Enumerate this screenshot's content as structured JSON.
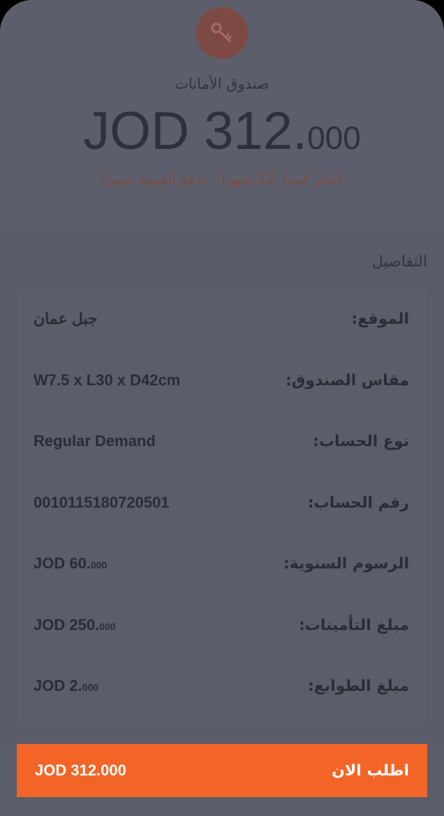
{
  "header": {
    "icon": "key-icon",
    "title": "صندوق الأمانات",
    "amount_main": "JOD 312.",
    "amount_decimals": "000",
    "note": "ايجار لمدة 12 شهرا ، تدفع القيمة سنويا"
  },
  "details": {
    "title": "التفاصيل",
    "rows": [
      {
        "label": "الموقع:",
        "value": "جبل عمان",
        "decimals": ""
      },
      {
        "label": "مقاس الصندوق:",
        "value": "W7.5 x L30 x D42cm",
        "decimals": ""
      },
      {
        "label": "نوع الحساب:",
        "value": "Regular Demand",
        "decimals": ""
      },
      {
        "label": "رقم الحساب:",
        "value": "0010115180720501",
        "decimals": ""
      },
      {
        "label": "الرسوم السنوية:",
        "value": "JOD 60.",
        "decimals": "000"
      },
      {
        "label": "مبلغ التأمينات:",
        "value": "JOD 250.",
        "decimals": "000"
      },
      {
        "label": "مبلغ الطوابع:",
        "value": "JOD 2.",
        "decimals": "000"
      }
    ]
  },
  "order": {
    "price": "JOD 312.000",
    "label": "اطلب الان"
  },
  "colors": {
    "accent": "#f26527",
    "key_circle": "#7d4a43",
    "note_text": "#7a4b45",
    "background": "#5b5c69"
  }
}
